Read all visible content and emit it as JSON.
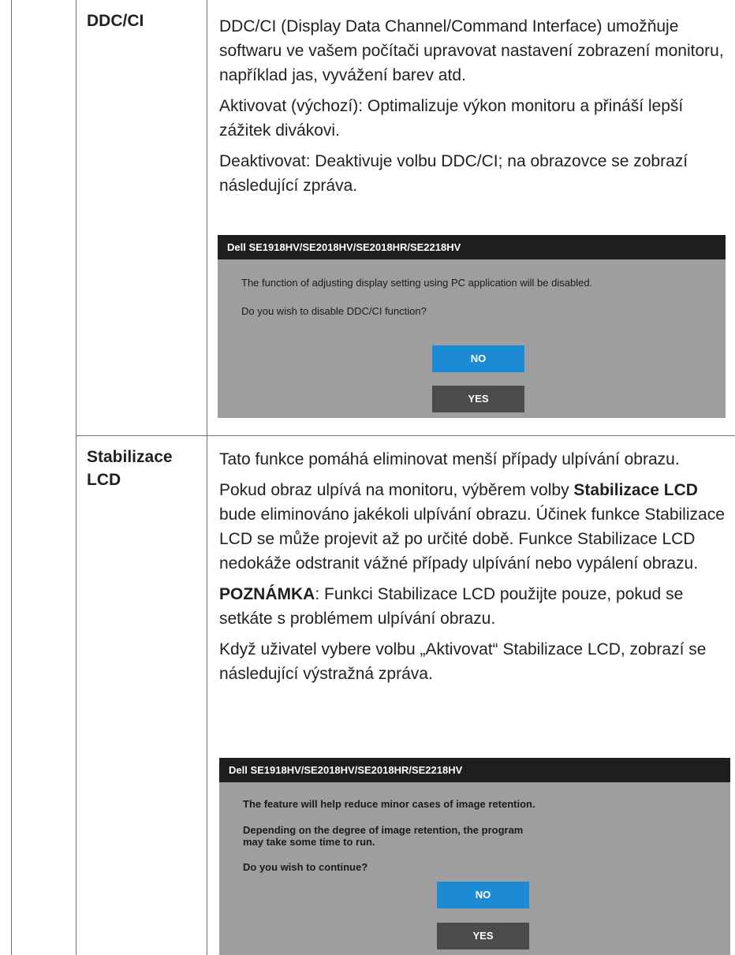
{
  "rows": [
    {
      "label": "DDC/CI",
      "paragraphs": [
        "DDC/CI (Display Data Channel/Command Interface) umožňuje softwaru ve vašem počítači upravovat nastavení zobrazení monitoru, například jas, vyvážení barev atd.",
        "Aktivovat (výchozí): Optimalizuje výkon monitoru a přináší lepší zážitek divákovi.",
        "Deaktivovat: Deaktivuje volbu DDC/CI; na obrazovce se zobrazí následující zpráva."
      ],
      "dialog": {
        "title": "Dell SE1918HV/SE2018HV/SE2018HR/SE2218HV",
        "messages": [
          "The function of adjusting display setting using PC application will be disabled.",
          "Do you wish to disable DDC/CI function?"
        ],
        "no_label": "NO",
        "yes_label": "YES"
      }
    },
    {
      "label": "Stabilizace LCD",
      "paragraphs": [
        "Tato funkce pomáhá eliminovat menší případy ulpívání obrazu.",
        "Pokud obraz ulpívá na monitoru, výběrem volby",
        "Stabilizace LCD",
        "bude eliminováno jakékoli ulpívání obrazu. Účinek funkce Stabilizace LCD se může projevit až po určité době. Funkce Stabilizace LCD nedokáže odstranit vážné případy ulpívání nebo vypálení obrazu.",
        "POZNÁMKA",
        ": Funkci Stabilizace LCD použijte pouze, pokud se setkáte s problémem ulpívání obrazu.",
        "Když uživatel vybere volbu „Aktivovat“ Stabilizace LCD, zobrazí se následující výstražná zpráva."
      ],
      "dialog": {
        "title": "Dell SE1918HV/SE2018HV/SE2018HR/SE2218HV",
        "messages": [
          "The feature will help reduce minor cases of image retention.",
          "Depending on the degree of image retention, the program may take some time to run.",
          "Do you wish to continue?"
        ],
        "no_label": "NO",
        "yes_label": "YES"
      }
    }
  ]
}
